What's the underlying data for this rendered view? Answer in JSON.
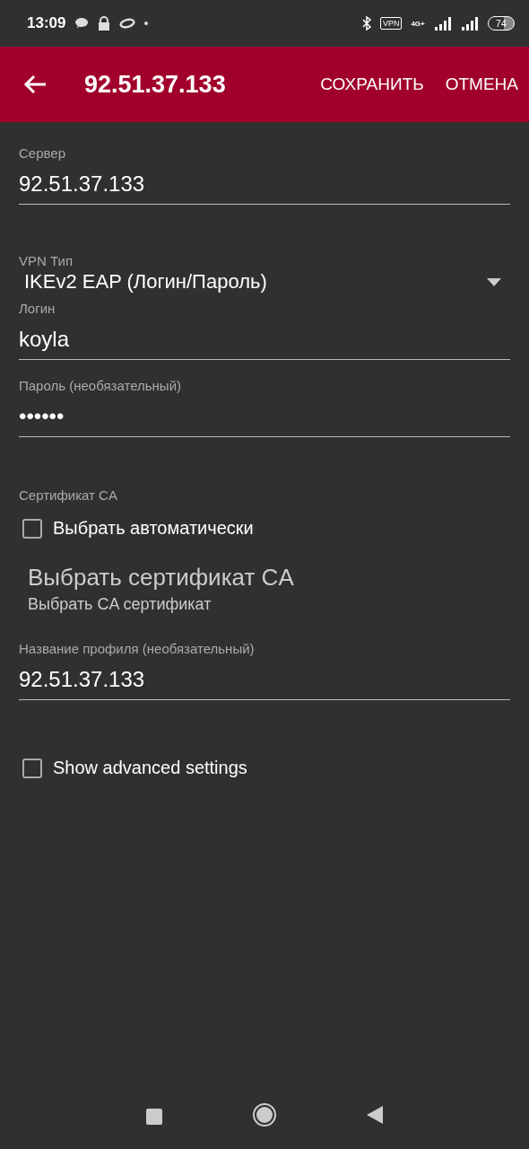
{
  "status_bar": {
    "time": "13:09",
    "vpn": "VPN",
    "network": "4G+",
    "battery": "74"
  },
  "app_bar": {
    "title": "92.51.37.133",
    "actions": [
      "СОХРАНИТЬ",
      "ОТМЕНА"
    ]
  },
  "server": {
    "label": "Сервер",
    "value": "92.51.37.133"
  },
  "vpn_type": {
    "label": "VPN Тип",
    "value": "IKEv2 EAP (Логин/Пароль)"
  },
  "login": {
    "label": "Логин",
    "value": "koyla"
  },
  "password": {
    "label": "Пароль (необязательный)",
    "value": "••••••"
  },
  "ca_certificate": {
    "label": "Сертификат CA",
    "auto": {
      "label": "Выбрать автоматически",
      "checked": false
    },
    "title": "Выбрать сертификат CA",
    "subtitle": "Выбрать CA сертификат"
  },
  "profile_name": {
    "label": "Название профиля (необязательный)",
    "value": "92.51.37.133"
  },
  "advanced": {
    "label": "Show advanced settings",
    "checked": false
  }
}
